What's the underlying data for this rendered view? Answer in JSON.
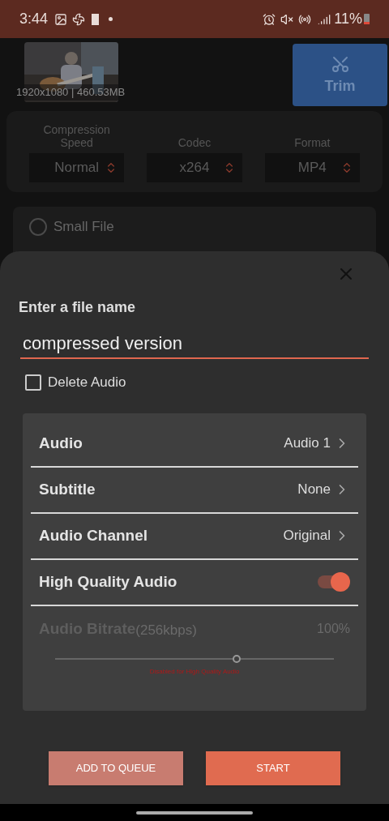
{
  "status_bar": {
    "time": "3:44",
    "battery": "11%"
  },
  "video": {
    "info": "1920x1080 | 460.53MB"
  },
  "trim_button": {
    "label": "Trim"
  },
  "options": [
    {
      "label": "Compression Speed",
      "value": "Normal"
    },
    {
      "label": "Codec",
      "value": "x264"
    },
    {
      "label": "Format",
      "value": "MP4"
    }
  ],
  "presets": [
    {
      "label": "Small File",
      "selected": false
    }
  ],
  "sheet": {
    "title": "Enter a file name",
    "file_name": "compressed version",
    "delete_audio": {
      "label": "Delete Audio",
      "checked": false
    },
    "rows": [
      {
        "kind": "select",
        "label": "Audio",
        "value": "Audio 1"
      },
      {
        "kind": "select",
        "label": "Subtitle",
        "value": "None"
      },
      {
        "kind": "select",
        "label": "Audio Channel",
        "value": "Original"
      },
      {
        "kind": "switch",
        "label": "High Quality Audio",
        "on": true
      }
    ],
    "bitrate": {
      "label": "Audio Bitrate",
      "detail": "(256kbps)",
      "reading": "100%",
      "level": 0.65,
      "disabled": true,
      "note": "Disabled for High Quality Audio"
    },
    "buttons": [
      {
        "kind": "secondary",
        "label": "ADD TO QUEUE"
      },
      {
        "kind": "primary",
        "label": "START"
      }
    ]
  }
}
